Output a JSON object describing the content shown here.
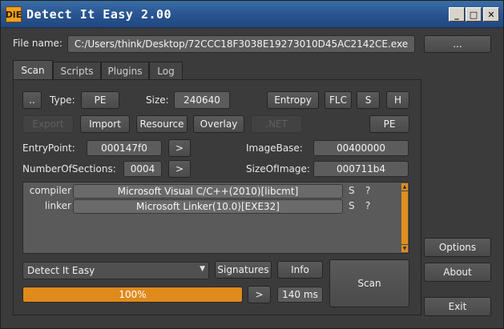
{
  "window": {
    "title": "Detect It Easy 2.00",
    "icon_text": "DiE",
    "minimize_glyph": "_",
    "maximize_glyph": "□",
    "close_glyph": "✕"
  },
  "file": {
    "label": "File name:",
    "path": "C:/Users/think/Desktop/72CCC18F3038E19273010D45AC2142CE.exe",
    "browse_label": "..."
  },
  "tabs": [
    {
      "label": "Scan",
      "active": true
    },
    {
      "label": "Scripts",
      "active": false
    },
    {
      "label": "Plugins",
      "active": false
    },
    {
      "label": "Log",
      "active": false
    }
  ],
  "scan": {
    "menu_button": "..",
    "type_label": "Type:",
    "type_value": "PE",
    "size_label": "Size:",
    "size_value": "240640",
    "entropy_button": "Entropy",
    "flc_button": "FLC",
    "s_button": "S",
    "h_button": "H",
    "export_button": "Export",
    "import_button": "Import",
    "resource_button": "Resource",
    "overlay_button": "Overlay",
    "net_button": ".NET",
    "pe_button": "PE",
    "entrypoint_label": "EntryPoint:",
    "entrypoint_value": "000147f0",
    "entrypoint_go": ">",
    "imagebase_label": "ImageBase:",
    "imagebase_value": "00400000",
    "numsections_label": "NumberOfSections:",
    "numsections_value": "0004",
    "numsections_go": ">",
    "sizeofimage_label": "SizeOfImage:",
    "sizeofimage_value": "000711b4"
  },
  "results": [
    {
      "type": "compiler",
      "name": "Microsoft Visual C/C++(2010)[libcmt]",
      "s": "S",
      "q": "?"
    },
    {
      "type": "linker",
      "name": "Microsoft Linker(10.0)[EXE32]",
      "s": "S",
      "q": "?"
    }
  ],
  "bottom": {
    "engine_selected": "Detect It Easy",
    "signatures_button": "Signatures",
    "info_button": "Info",
    "scan_button": "Scan",
    "progress_percent": 100,
    "progress_text": "100%",
    "next_button": ">",
    "time_text": "140 ms"
  },
  "side": {
    "options_button": "Options",
    "about_button": "About",
    "exit_button": "Exit"
  },
  "colors": {
    "accent": "#e08a1c",
    "background": "#3b3b3b",
    "titlebar": "#2a5592"
  }
}
